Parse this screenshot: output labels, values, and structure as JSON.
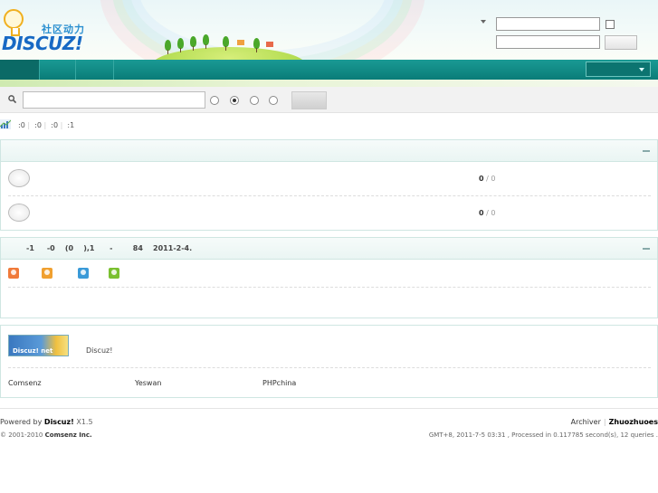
{
  "header": {
    "logo_cn": "社区动力",
    "logo_text": "DISCUZ!"
  },
  "stats": {
    "items": [
      ":0",
      ":0",
      ":0",
      ":1"
    ]
  },
  "forums": [
    {
      "threads": "0",
      "posts": "0"
    },
    {
      "threads": "0",
      "posts": "0"
    }
  ],
  "online": {
    "summary": "-1     -0    (0    ),1      -        84    2011-2-4.",
    "icon_colors": [
      "#f07a3a",
      "#f0a030",
      "#3a9ad8",
      "#7ac030"
    ]
  },
  "partners": {
    "logo_label": "Discuz! net",
    "description": "Discuz!",
    "links": [
      "Comsenz",
      "Yeswan",
      "PHPchina"
    ]
  },
  "footer": {
    "powered_by": "Powered by",
    "brand": "Discuz!",
    "version": "X1.5",
    "copyright": "© 2001-2010",
    "company": "Comsenz Inc.",
    "archiver": "Archiver",
    "site": "Zhuozhuoes",
    "timing": "GMT+8, 2011-7-5 03:31 , Processed in 0.117785 second(s), 12 queries ."
  }
}
